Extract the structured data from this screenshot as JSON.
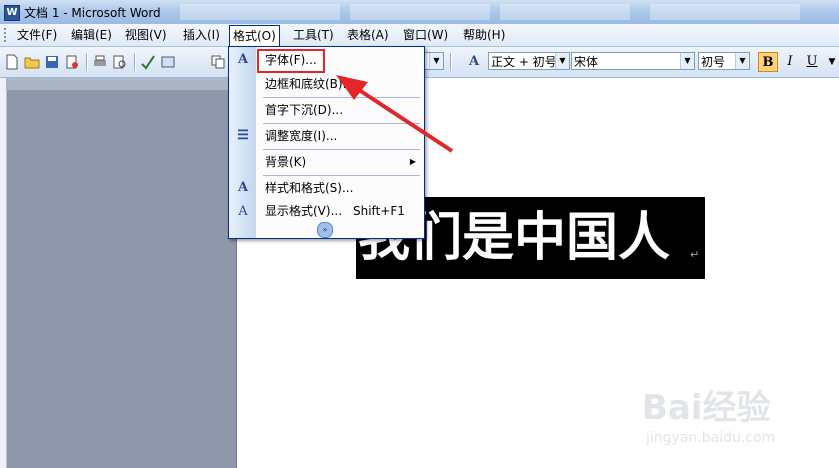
{
  "window": {
    "title": "文档 1 - Microsoft Word"
  },
  "menubar": {
    "items": [
      "文件(F)",
      "编辑(E)",
      "视图(V)",
      "插入(I)",
      "格式(O)",
      "工具(T)",
      "表格(A)",
      "窗口(W)",
      "帮助(H)"
    ],
    "open_item": "格式(O)"
  },
  "toolbar": {
    "style_box": "正文 + 初号",
    "font_box": "宋体",
    "size_box": "初号",
    "bold_label": "B",
    "italic_label": "I",
    "underline_label": "U",
    "style_icon": "styles-icon"
  },
  "format_menu": {
    "items": [
      {
        "label": "字体(F)...",
        "icon": "font-icon",
        "glyph": "A"
      },
      {
        "label": "边框和底纹(B)...",
        "icon": "",
        "glyph": ""
      },
      {
        "label": "首字下沉(D)...",
        "icon": "",
        "glyph": ""
      },
      {
        "label": "调整宽度(I)...",
        "icon": "adjust-width-icon",
        "glyph": "☰"
      },
      {
        "label": "背景(K)",
        "icon": "",
        "glyph": "",
        "submenu": "▶"
      },
      {
        "label": "样式和格式(S)...",
        "icon": "styles-formatting-icon",
        "glyph": "A"
      },
      {
        "label": "显示格式(V)...",
        "shortcut": "Shift+F1",
        "icon": "reveal-formatting-icon",
        "glyph": "A"
      }
    ],
    "expand_glyph": "»"
  },
  "document": {
    "highlighted_text": "我们是中国人",
    "paragraph_mark": "↵"
  },
  "annotation": {
    "color": "#e4262b"
  },
  "watermark": {
    "logo": "Bai经验",
    "url": "jingyan.baidu.com"
  },
  "colors": {
    "menu_border": "#002d96",
    "title_gradient": "#a9c7ea",
    "bold_active": "#ffd07a"
  }
}
